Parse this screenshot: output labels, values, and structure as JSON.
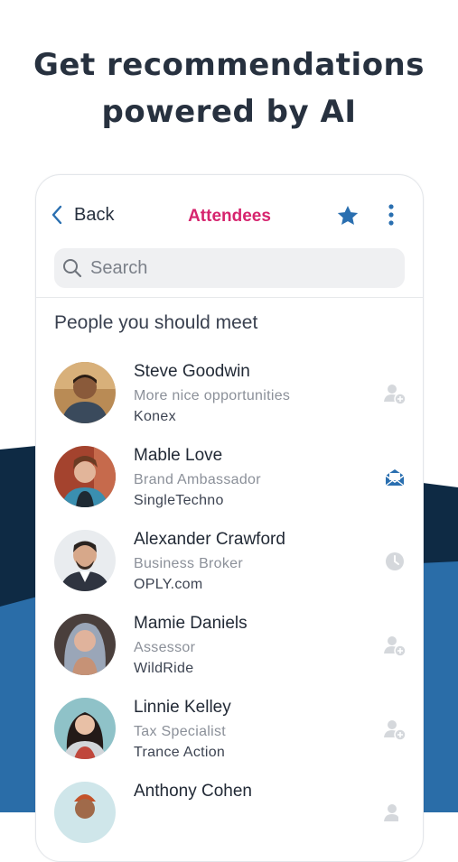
{
  "headline": {
    "line1": "Get recommendations",
    "line2": "powered by AI"
  },
  "colors": {
    "navy": "#0e2a44",
    "blue": "#2a6da8",
    "accent_pink": "#d6246e",
    "star_blue": "#2a6fb0"
  },
  "header": {
    "back_label": "Back",
    "title": "Attendees"
  },
  "search": {
    "placeholder": "Search"
  },
  "section": {
    "title": "People you should meet"
  },
  "people": [
    {
      "name": "Steve Goodwin",
      "role": "More nice opportunities",
      "company": "Konex",
      "action_icon": "add-contact-icon"
    },
    {
      "name": "Mable Love",
      "role": "Brand Ambassador",
      "company": "SingleTechno",
      "action_icon": "open-mail-icon"
    },
    {
      "name": "Alexander Crawford",
      "role": "Business Broker",
      "company": "OPLY.com",
      "action_icon": "clock-icon"
    },
    {
      "name": "Mamie Daniels",
      "role": "Assessor",
      "company": "WildRide",
      "action_icon": "add-contact-icon"
    },
    {
      "name": "Linnie Kelley",
      "role": "Tax Specialist",
      "company": "Trance Action",
      "action_icon": "add-contact-icon"
    },
    {
      "name": "Anthony Cohen",
      "role": "",
      "company": "",
      "action_icon": "add-contact-icon"
    }
  ]
}
